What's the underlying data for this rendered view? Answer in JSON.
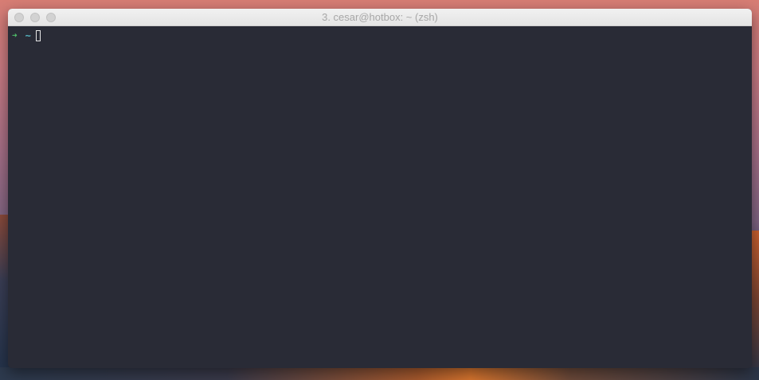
{
  "window": {
    "title": "3. cesar@hotbox: ~ (zsh)"
  },
  "terminal": {
    "prompt_symbol": "➜",
    "cwd": "~",
    "input": ""
  },
  "colors": {
    "terminal_bg": "#292b36",
    "prompt_green": "#4fc06a",
    "cwd_cyan": "#56b6c2",
    "titlebar": "#ececec"
  }
}
